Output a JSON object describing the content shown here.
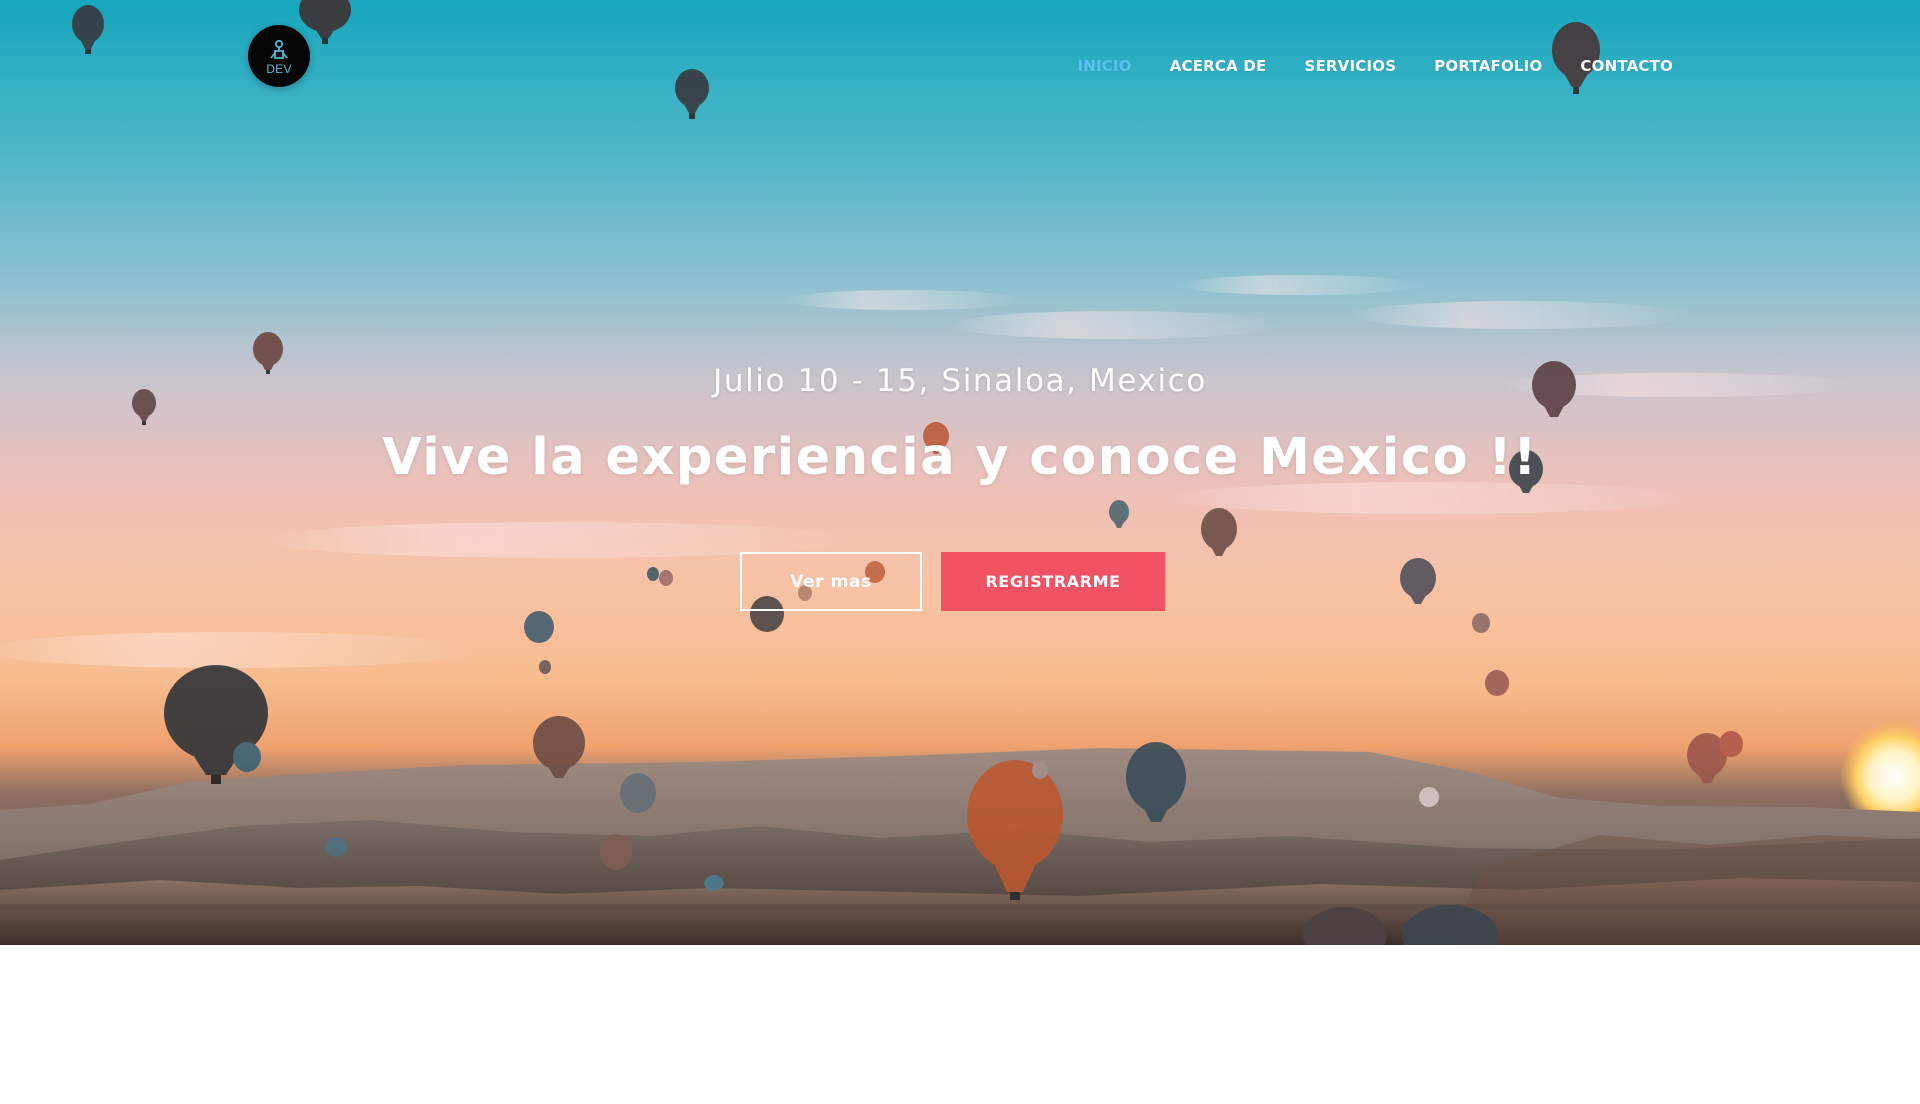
{
  "brand": {
    "logo_text": "DEV",
    "logo_icon": "user-network-icon",
    "accent_color": "#58c2f0"
  },
  "nav": {
    "items": [
      {
        "label": "INICIO",
        "active": true
      },
      {
        "label": "ACERCA DE",
        "active": false
      },
      {
        "label": "SERVICIOS",
        "active": false
      },
      {
        "label": "PORTAFOLIO",
        "active": false
      },
      {
        "label": "CONTACTO",
        "active": false
      }
    ]
  },
  "hero": {
    "subtitle": "Julio 10 - 15, Sinaloa, Mexico",
    "title": "Vive la experiencia y conoce Mexico !!",
    "buttons": {
      "secondary": "Ver mas",
      "primary": "REGISTRARME"
    },
    "background_image": "hot-air-balloons-sunset-landscape",
    "primary_color": "#f15364",
    "line_color": "#2ab6d1"
  }
}
